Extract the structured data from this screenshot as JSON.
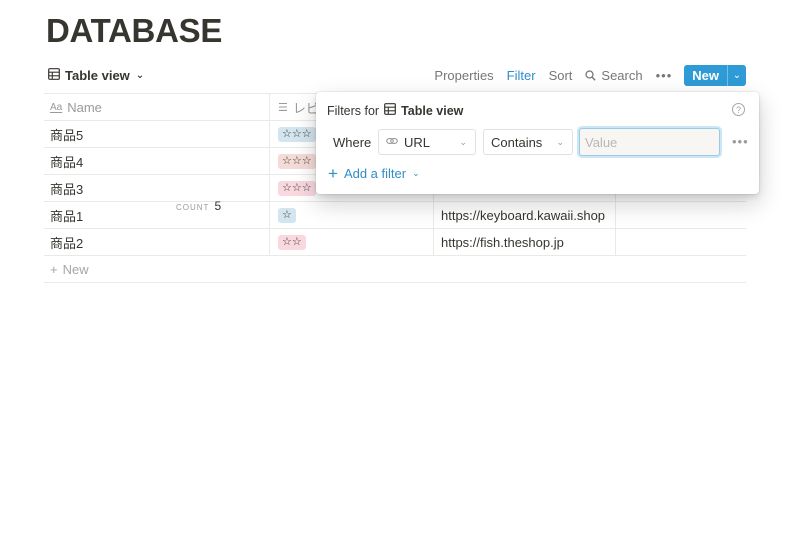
{
  "page": {
    "title": "DATABASE"
  },
  "toolbar": {
    "view_label": "Table view",
    "properties": "Properties",
    "filter": "Filter",
    "sort": "Sort",
    "search": "Search",
    "more": "•••",
    "new": "New",
    "accent_color": "#2e9bd6"
  },
  "table": {
    "columns": [
      {
        "label": "Name",
        "icon": "text-property-icon"
      },
      {
        "label": "レビ",
        "icon": "list-property-icon"
      }
    ],
    "rows": [
      {
        "name": "商品5",
        "rating": "☆☆☆",
        "tag_color": "#d3e5ef",
        "url": ""
      },
      {
        "name": "商品4",
        "rating": "☆☆☆",
        "tag_color": "#f5dbd8",
        "url": ""
      },
      {
        "name": "商品3",
        "rating": "☆☆☆",
        "tag_color": "#f9d8e0",
        "url": ""
      },
      {
        "name": "商品1",
        "rating": "☆",
        "tag_color": "#d3e5ef",
        "url": "https://keyboard.kawaii.shop"
      },
      {
        "name": "商品2",
        "rating": "☆☆",
        "tag_color": "#f9d8e0",
        "url": "https://fish.theshop.jp"
      }
    ],
    "new_row_label": "New",
    "count_label": "COUNT",
    "count_value": "5"
  },
  "filter_popup": {
    "title_prefix": "Filters for",
    "view_name": "Table view",
    "where": "Where",
    "property": "URL",
    "operator": "Contains",
    "value_placeholder": "Value",
    "value": "",
    "add_filter": "Add a filter",
    "help": "?"
  }
}
